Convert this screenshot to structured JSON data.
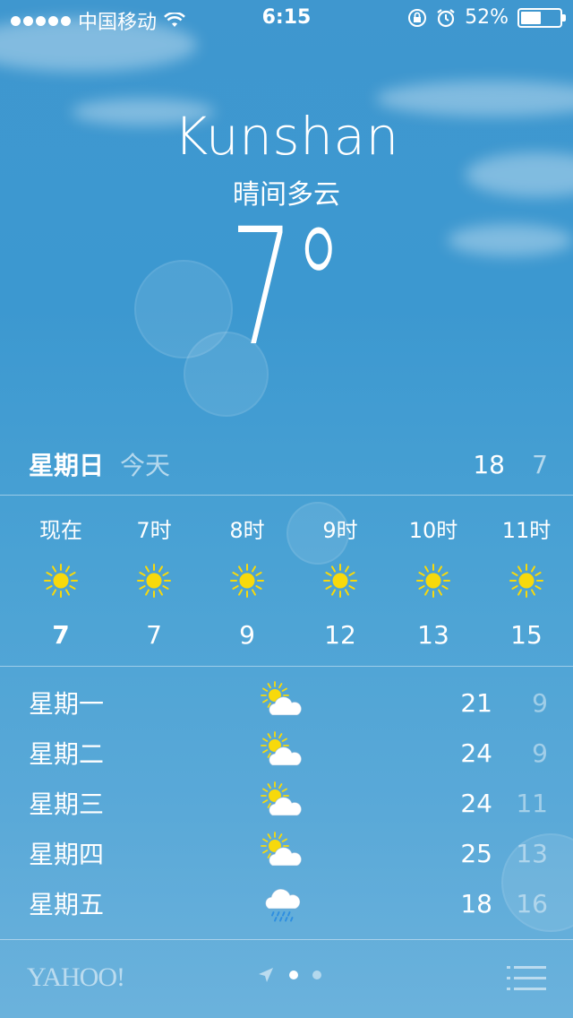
{
  "status_bar": {
    "carrier": "中国移动",
    "time": "6:15",
    "battery_percent": "52%",
    "battery_level": 0.52,
    "icons": [
      "signal-dots",
      "wifi-icon",
      "rotation-lock-icon",
      "alarm-icon",
      "battery-icon"
    ]
  },
  "header": {
    "city": "Kunshan",
    "condition": "晴间多云",
    "temperature": "7°"
  },
  "today": {
    "day": "星期日",
    "label": "今天",
    "high": "18",
    "low": "7"
  },
  "hourly": [
    {
      "label": "现在",
      "icon": "sun-icon",
      "temp": "7"
    },
    {
      "label": "7时",
      "icon": "sun-icon",
      "temp": "7"
    },
    {
      "label": "8时",
      "icon": "sun-icon",
      "temp": "9"
    },
    {
      "label": "9时",
      "icon": "sun-icon",
      "temp": "12"
    },
    {
      "label": "10时",
      "icon": "sun-icon",
      "temp": "13"
    },
    {
      "label": "11时",
      "icon": "sun-icon",
      "temp": "15"
    }
  ],
  "daily": [
    {
      "day": "星期一",
      "icon": "partly-cloudy-icon",
      "high": "21",
      "low": "9"
    },
    {
      "day": "星期二",
      "icon": "partly-cloudy-icon",
      "high": "24",
      "low": "9"
    },
    {
      "day": "星期三",
      "icon": "partly-cloudy-icon",
      "high": "24",
      "low": "11"
    },
    {
      "day": "星期四",
      "icon": "partly-cloudy-icon",
      "high": "25",
      "low": "13"
    },
    {
      "day": "星期五",
      "icon": "rain-cloud-icon",
      "high": "18",
      "low": "16"
    }
  ],
  "footer": {
    "brand": "YAHOO!",
    "page_count": 2,
    "current_page": 1
  },
  "colors": {
    "sun": "#f7d90c",
    "sky_top": "#3f97cf",
    "sky_bottom": "#6bb2dc",
    "rain": "#2f8fe0"
  }
}
